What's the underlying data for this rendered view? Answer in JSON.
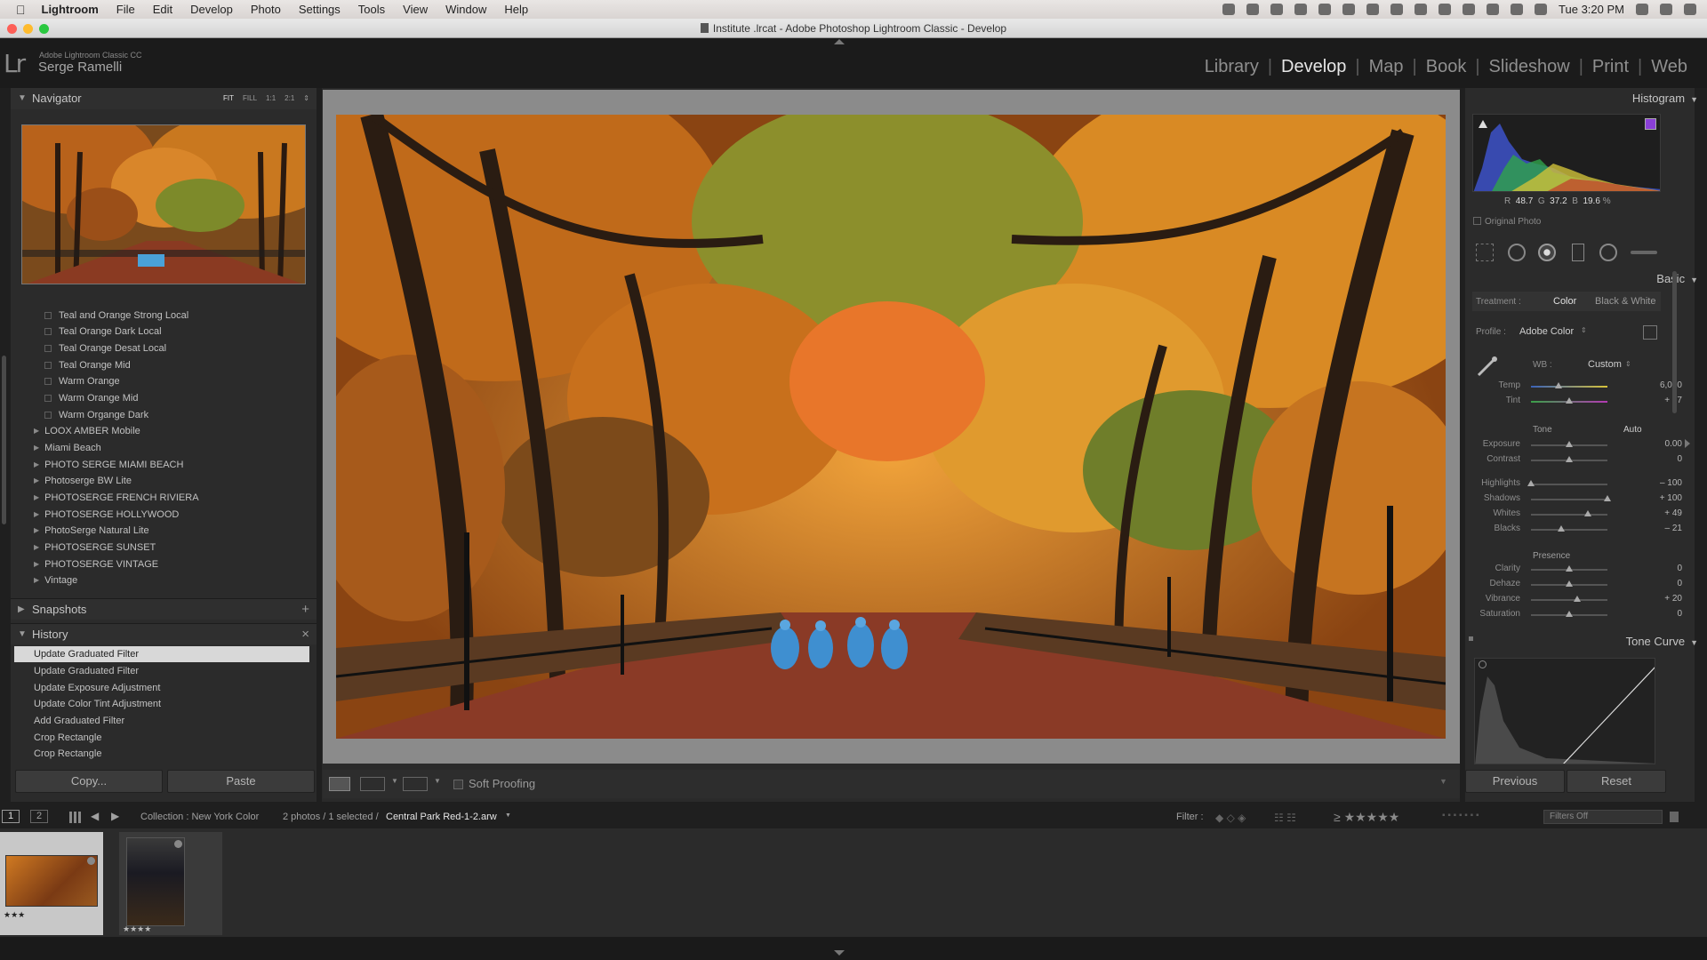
{
  "menubar": {
    "apple": "",
    "app": "Lightroom",
    "items": [
      "File",
      "Edit",
      "Develop",
      "Photo",
      "Settings",
      "Tools",
      "View",
      "Window",
      "Help"
    ],
    "clock": "Tue 3:20 PM"
  },
  "window": {
    "title": "Institute .lrcat - Adobe Photoshop Lightroom Classic - Develop"
  },
  "identity": {
    "logo": "Lr",
    "product": "Adobe Lightroom Classic CC",
    "user": "Serge Ramelli"
  },
  "modules": [
    "Library",
    "Develop",
    "Map",
    "Book",
    "Slideshow",
    "Print",
    "Web"
  ],
  "active_module": "Develop",
  "left": {
    "navigator": {
      "title": "Navigator",
      "zoom": [
        "FIT",
        "FILL",
        "1:1",
        "2:1"
      ]
    },
    "presets": [
      "Teal and Orange Strong Local",
      "Teal Orange Dark Local",
      "Teal Orange Desat Local",
      "Teal Orange Mid",
      "Warm Orange",
      "Warm Orange Mid",
      "Warm Organge Dark"
    ],
    "folders": [
      "LOOX AMBER Mobile",
      "Miami Beach",
      "PHOTO SERGE MIAMI BEACH",
      "Photoserge BW Lite",
      "PHOTOSERGE FRENCH RIVIERA",
      "PHOTOSERGE HOLLYWOOD",
      "PhotoSerge Natural Lite",
      "PHOTOSERGE SUNSET",
      "PHOTOSERGE VINTAGE",
      "Vintage"
    ],
    "snapshots": {
      "title": "Snapshots",
      "action": "+"
    },
    "history": {
      "title": "History",
      "action": "×",
      "items": [
        "Update Graduated Filter",
        "Update Graduated Filter",
        "Update Exposure Adjustment",
        "Update Color Tint Adjustment",
        "Add Graduated Filter",
        "Crop Rectangle",
        "Crop Rectangle"
      ]
    },
    "copy_label": "Copy...",
    "paste_label": "Paste"
  },
  "toolbar": {
    "soft_proofing": "Soft Proofing"
  },
  "right": {
    "histogram": {
      "title": "Histogram",
      "r_label": "R",
      "r": "48.7",
      "g_label": "G",
      "g": "37.2",
      "b_label": "B",
      "b": "19.6",
      "unit": "%",
      "original_photo": "Original Photo"
    },
    "basic": {
      "title": "Basic",
      "treatment_label": "Treatment :",
      "treatment_color": "Color",
      "treatment_bw": "Black & White",
      "profile_label": "Profile :",
      "profile_value": "Adobe Color",
      "wb_label": "WB :",
      "wb_value": "Custom",
      "tone_label": "Tone",
      "auto_label": "Auto",
      "presence_label": "Presence"
    },
    "sliders": [
      {
        "label": "Temp",
        "value": "6,020",
        "pos": 0.36
      },
      {
        "label": "Tint",
        "value": "+ 27",
        "pos": 0.5
      },
      {
        "label": "Exposure",
        "value": "0.00",
        "pos": 0.5
      },
      {
        "label": "Contrast",
        "value": "0",
        "pos": 0.5
      },
      {
        "label": "Highlights",
        "value": "– 100",
        "pos": 0.0
      },
      {
        "label": "Shadows",
        "value": "+ 100",
        "pos": 1.0
      },
      {
        "label": "Whites",
        "value": "+ 49",
        "pos": 0.74
      },
      {
        "label": "Blacks",
        "value": "– 21",
        "pos": 0.39
      },
      {
        "label": "Clarity",
        "value": "0",
        "pos": 0.5
      },
      {
        "label": "Dehaze",
        "value": "0",
        "pos": 0.5
      },
      {
        "label": "Vibrance",
        "value": "+ 20",
        "pos": 0.6
      },
      {
        "label": "Saturation",
        "value": "0",
        "pos": 0.5
      }
    ],
    "tone_curve": {
      "title": "Tone Curve"
    },
    "previous_label": "Previous",
    "reset_label": "Reset"
  },
  "filmbar": {
    "page1": "1",
    "page2": "2",
    "collection": "Collection : New York Color",
    "count": "2 photos / 1 selected /",
    "filename": "Central Park Red-1-2.arw",
    "filter_label": "Filter :",
    "filters_off": "Filters Off"
  },
  "filmstrip": {
    "thumb1_rating": "★★★",
    "thumb2_rating": "★★★★"
  },
  "colors": {
    "accent_purple": "#8a3fd6",
    "panel": "#2b2b2b",
    "dark": "#1b1b1b"
  }
}
